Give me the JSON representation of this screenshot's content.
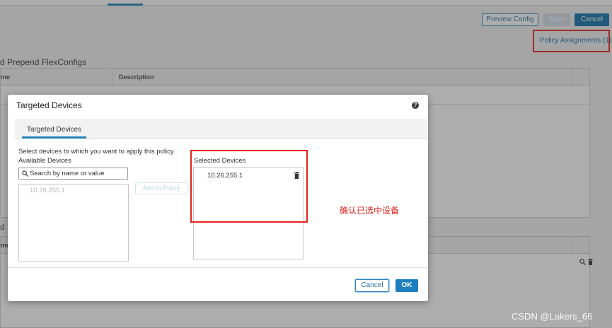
{
  "background": {
    "buttons": {
      "preview_config": "Preview Config",
      "save": "Save",
      "cancel": "Cancel"
    },
    "policy_assignments_link": "Policy Assignments (1)",
    "section1_title": "d Prepend FlexConfigs",
    "table1_headers": [
      "me",
      "Description"
    ],
    "section2_title": "d",
    "table2_header": "me"
  },
  "modal": {
    "title": "Targeted Devices",
    "help_icon": "question-icon",
    "tab_label": "Targeted Devices",
    "instruction": "Select devices to which you want to apply this policy.",
    "available_label": "Available Devices",
    "search_placeholder": "Search by name or value",
    "available_devices": [
      "10.26.255.1"
    ],
    "add_button": "Add to Policy",
    "selected_label": "Selected Devices",
    "selected_devices": [
      "10.26.255.1"
    ],
    "cancel_button": "Cancel",
    "ok_button": "OK"
  },
  "annotation_text": "确认已选中设备",
  "watermark": "CSDN @Lakers_66",
  "colors": {
    "accent": "#1f84b8",
    "primary_button": "#1b7fc0",
    "annotation_red": "#e2231a"
  }
}
